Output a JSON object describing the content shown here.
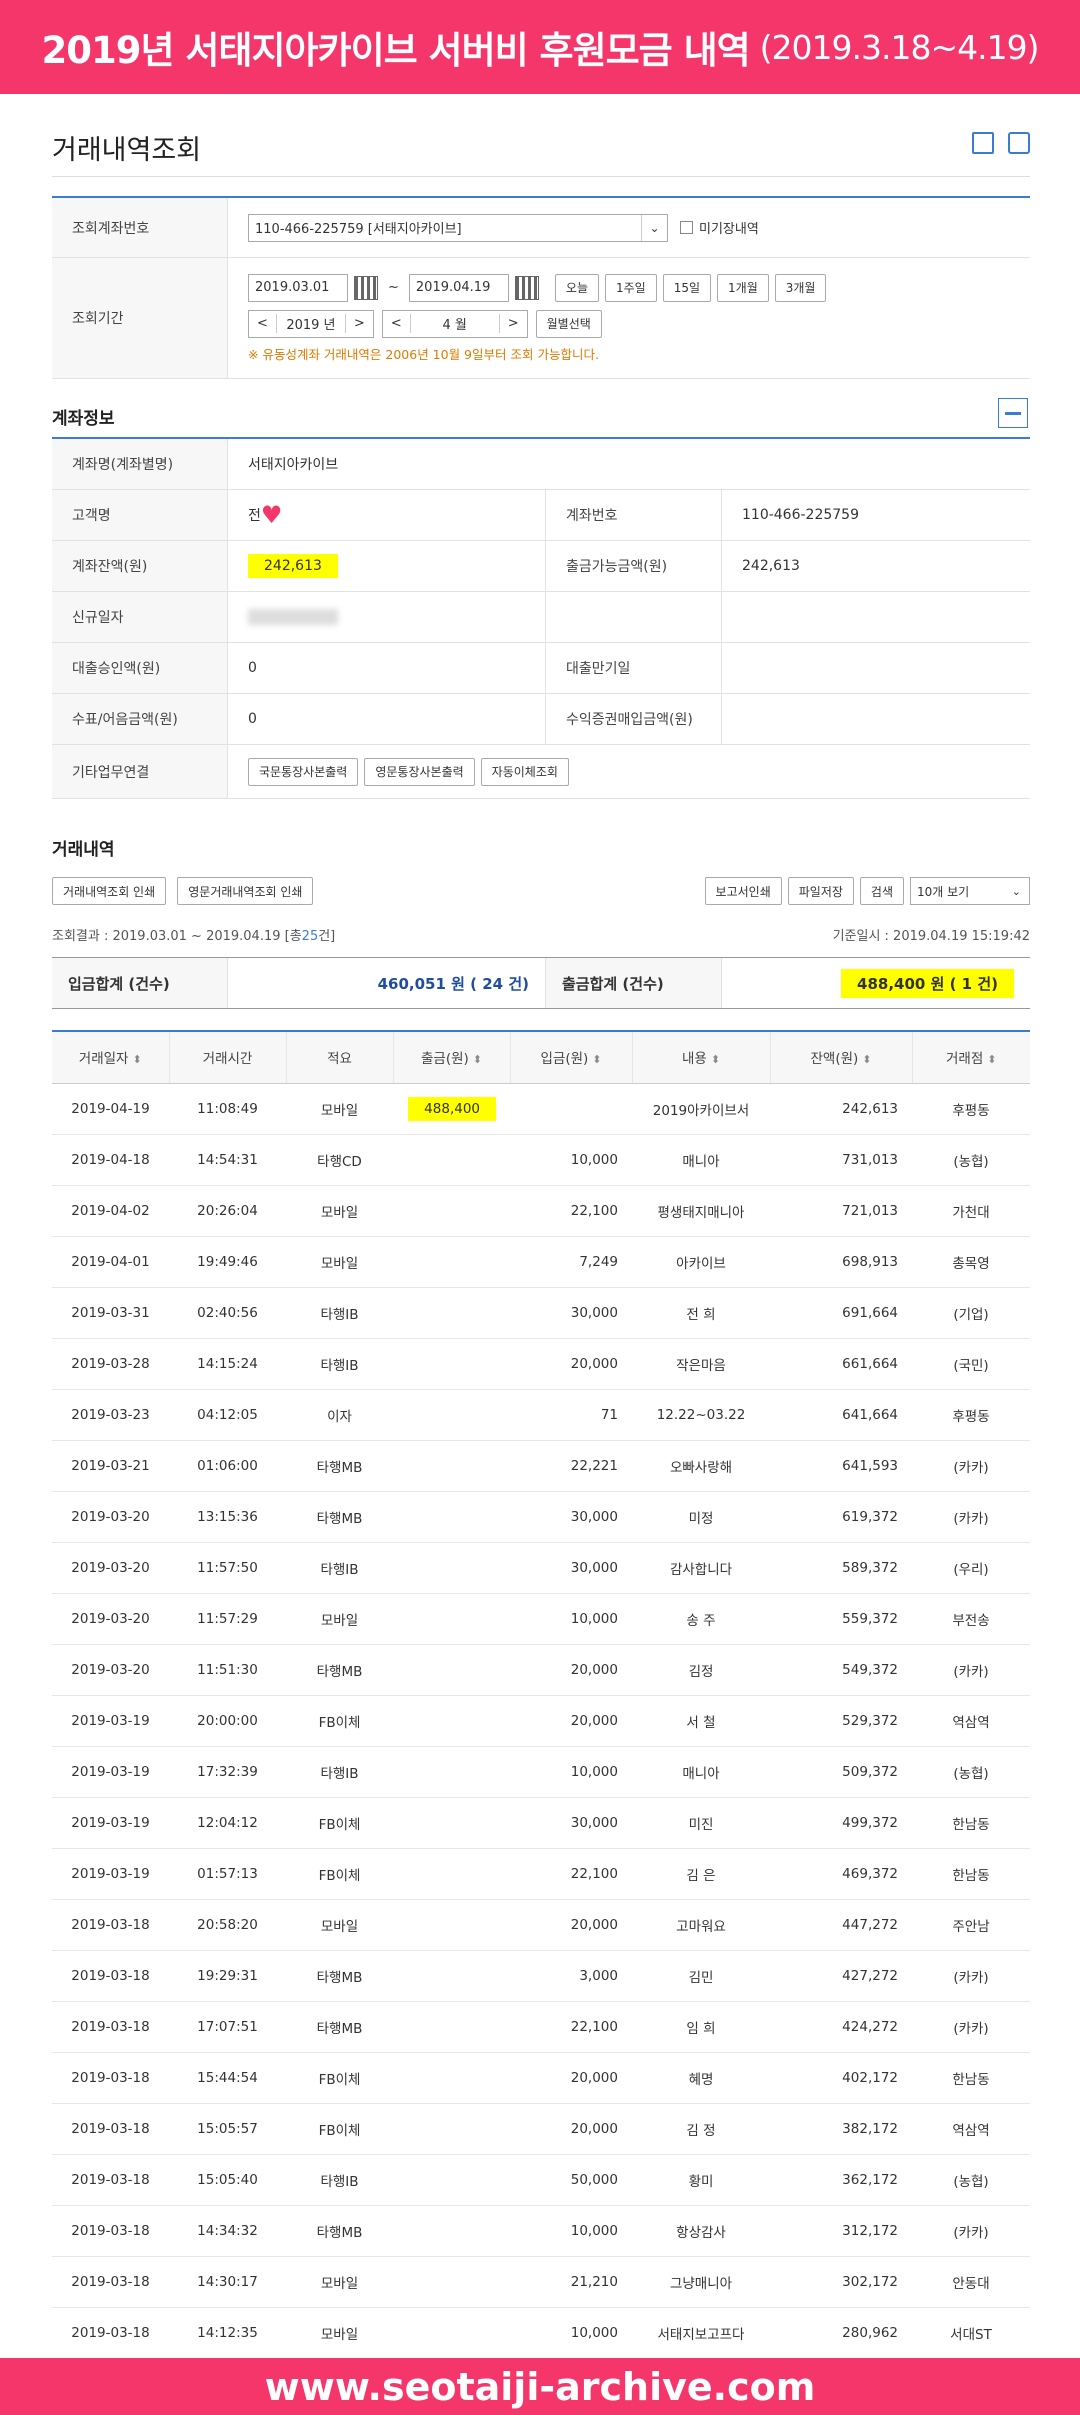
{
  "banner": {
    "title": "2019년 서태지아카이브 서버비 후원모금 내역",
    "period": "(2019.3.18~4.19)"
  },
  "footer": {
    "url": "www.seotaiji-archive.com"
  },
  "page": {
    "title": "거래내역조회"
  },
  "search": {
    "account_label": "조회계좌번호",
    "account_value": "110-466-225759 [서태지아카이브]",
    "unposted_label": "미기장내역",
    "period_label": "조회기간",
    "date_from": "2019.03.01",
    "date_sep": "~",
    "date_to": "2019.04.19",
    "quick": [
      "오늘",
      "1주일",
      "15일",
      "1개월",
      "3개월"
    ],
    "year": "2019 년",
    "month": "4 월",
    "month_select": "월별선택",
    "note": "※ 유동성계좌 거래내역은 2006년 10월 9일부터 조회 가능합니다."
  },
  "account": {
    "section_title": "계좌정보",
    "name_label": "계좌명(계좌별명)",
    "name_value": "서태지아카이브",
    "customer_label": "고객명",
    "customer_value": "전",
    "number_label": "계좌번호",
    "number_value": "110-466-225759",
    "balance_label": "계좌잔액(원)",
    "balance_value": "242,613",
    "withdrawable_label": "출금가능금액(원)",
    "withdrawable_value": "242,613",
    "opened_label": "신규일자",
    "loan_label": "대출승인액(원)",
    "loan_value": "0",
    "loan_due_label": "대출만기일",
    "check_label": "수표/어음금액(원)",
    "check_value": "0",
    "securities_label": "수익증권매입금액(원)",
    "other_label": "기타업무연결",
    "other_buttons": [
      "국문통장사본출력",
      "영문통장사본출력",
      "자동이체조회"
    ]
  },
  "history": {
    "section_title": "거래내역",
    "btn_print": "거래내역조회 인쇄",
    "btn_print_en": "영문거래내역조회 인쇄",
    "btn_report": "보고서인쇄",
    "btn_save": "파일저장",
    "btn_search": "검색",
    "view_count": "10개 보기",
    "result_prefix": "조회결과 : 2019.03.01 ~ 2019.04.19 [총",
    "result_count": "25",
    "result_suffix": "건]",
    "base_time": "기준일시 : 2019.04.19 15:19:42",
    "deposit_label": "입금합계 (건수)",
    "deposit_value": "460,051 원 ( 24 건)",
    "withdraw_label": "출금합계 (건수)",
    "withdraw_value": "488,400 원 ( 1 건)",
    "columns": [
      "거래일자",
      "거래시간",
      "적요",
      "출금(원)",
      "입금(원)",
      "내용",
      "잔액(원)",
      "거래점"
    ],
    "rows": [
      [
        "2019-04-19",
        "11:08:49",
        "모바일",
        "488,400",
        "",
        "2019아카이브서",
        "242,613",
        "후평동"
      ],
      [
        "2019-04-18",
        "14:54:31",
        "타행CD",
        "",
        "10,000",
        "매니아",
        "731,013",
        "(농협)"
      ],
      [
        "2019-04-02",
        "20:26:04",
        "모바일",
        "",
        "22,100",
        "평생태지매니아",
        "721,013",
        "가천대"
      ],
      [
        "2019-04-01",
        "19:49:46",
        "모바일",
        "",
        "7,249",
        "아카이브",
        "698,913",
        "총목영"
      ],
      [
        "2019-03-31",
        "02:40:56",
        "타행IB",
        "",
        "30,000",
        "전 희",
        "691,664",
        "(기업)"
      ],
      [
        "2019-03-28",
        "14:15:24",
        "타행IB",
        "",
        "20,000",
        "작은마음",
        "661,664",
        "(국민)"
      ],
      [
        "2019-03-23",
        "04:12:05",
        "이자",
        "",
        "71",
        "12.22~03.22",
        "641,664",
        "후평동"
      ],
      [
        "2019-03-21",
        "01:06:00",
        "타행MB",
        "",
        "22,221",
        "오빠사랑해",
        "641,593",
        "(카카)"
      ],
      [
        "2019-03-20",
        "13:15:36",
        "타행MB",
        "",
        "30,000",
        "미정",
        "619,372",
        "(카카)"
      ],
      [
        "2019-03-20",
        "11:57:50",
        "타행IB",
        "",
        "30,000",
        "감사합니다",
        "589,372",
        "(우리)"
      ],
      [
        "2019-03-20",
        "11:57:29",
        "모바일",
        "",
        "10,000",
        "송 주",
        "559,372",
        "부전송"
      ],
      [
        "2019-03-20",
        "11:51:30",
        "타행MB",
        "",
        "20,000",
        "김정",
        "549,372",
        "(카카)"
      ],
      [
        "2019-03-19",
        "20:00:00",
        "FB이체",
        "",
        "20,000",
        "서 철",
        "529,372",
        "역삼역"
      ],
      [
        "2019-03-19",
        "17:32:39",
        "타행IB",
        "",
        "10,000",
        "매니아",
        "509,372",
        "(농협)"
      ],
      [
        "2019-03-19",
        "12:04:12",
        "FB이체",
        "",
        "30,000",
        "미진",
        "499,372",
        "한남동"
      ],
      [
        "2019-03-19",
        "01:57:13",
        "FB이체",
        "",
        "22,100",
        "김 은",
        "469,372",
        "한남동"
      ],
      [
        "2019-03-18",
        "20:58:20",
        "모바일",
        "",
        "20,000",
        "고마워요",
        "447,272",
        "주안남"
      ],
      [
        "2019-03-18",
        "19:29:31",
        "타행MB",
        "",
        "3,000",
        "김민",
        "427,272",
        "(카카)"
      ],
      [
        "2019-03-18",
        "17:07:51",
        "타행MB",
        "",
        "22,100",
        "임 희",
        "424,272",
        "(카카)"
      ],
      [
        "2019-03-18",
        "15:44:54",
        "FB이체",
        "",
        "20,000",
        "혜명",
        "402,172",
        "한남동"
      ],
      [
        "2019-03-18",
        "15:05:57",
        "FB이체",
        "",
        "20,000",
        "김 정",
        "382,172",
        "역삼역"
      ],
      [
        "2019-03-18",
        "15:05:40",
        "타행IB",
        "",
        "50,000",
        "황미",
        "362,172",
        "(농협)"
      ],
      [
        "2019-03-18",
        "14:34:32",
        "타행MB",
        "",
        "10,000",
        "항상감사",
        "312,172",
        "(카카)"
      ],
      [
        "2019-03-18",
        "14:30:17",
        "모바일",
        "",
        "21,210",
        "그냥매니아",
        "302,172",
        "안동대"
      ],
      [
        "2019-03-18",
        "14:12:35",
        "모바일",
        "",
        "10,000",
        "서태지보고프다",
        "280,962",
        "서대ST"
      ]
    ]
  }
}
